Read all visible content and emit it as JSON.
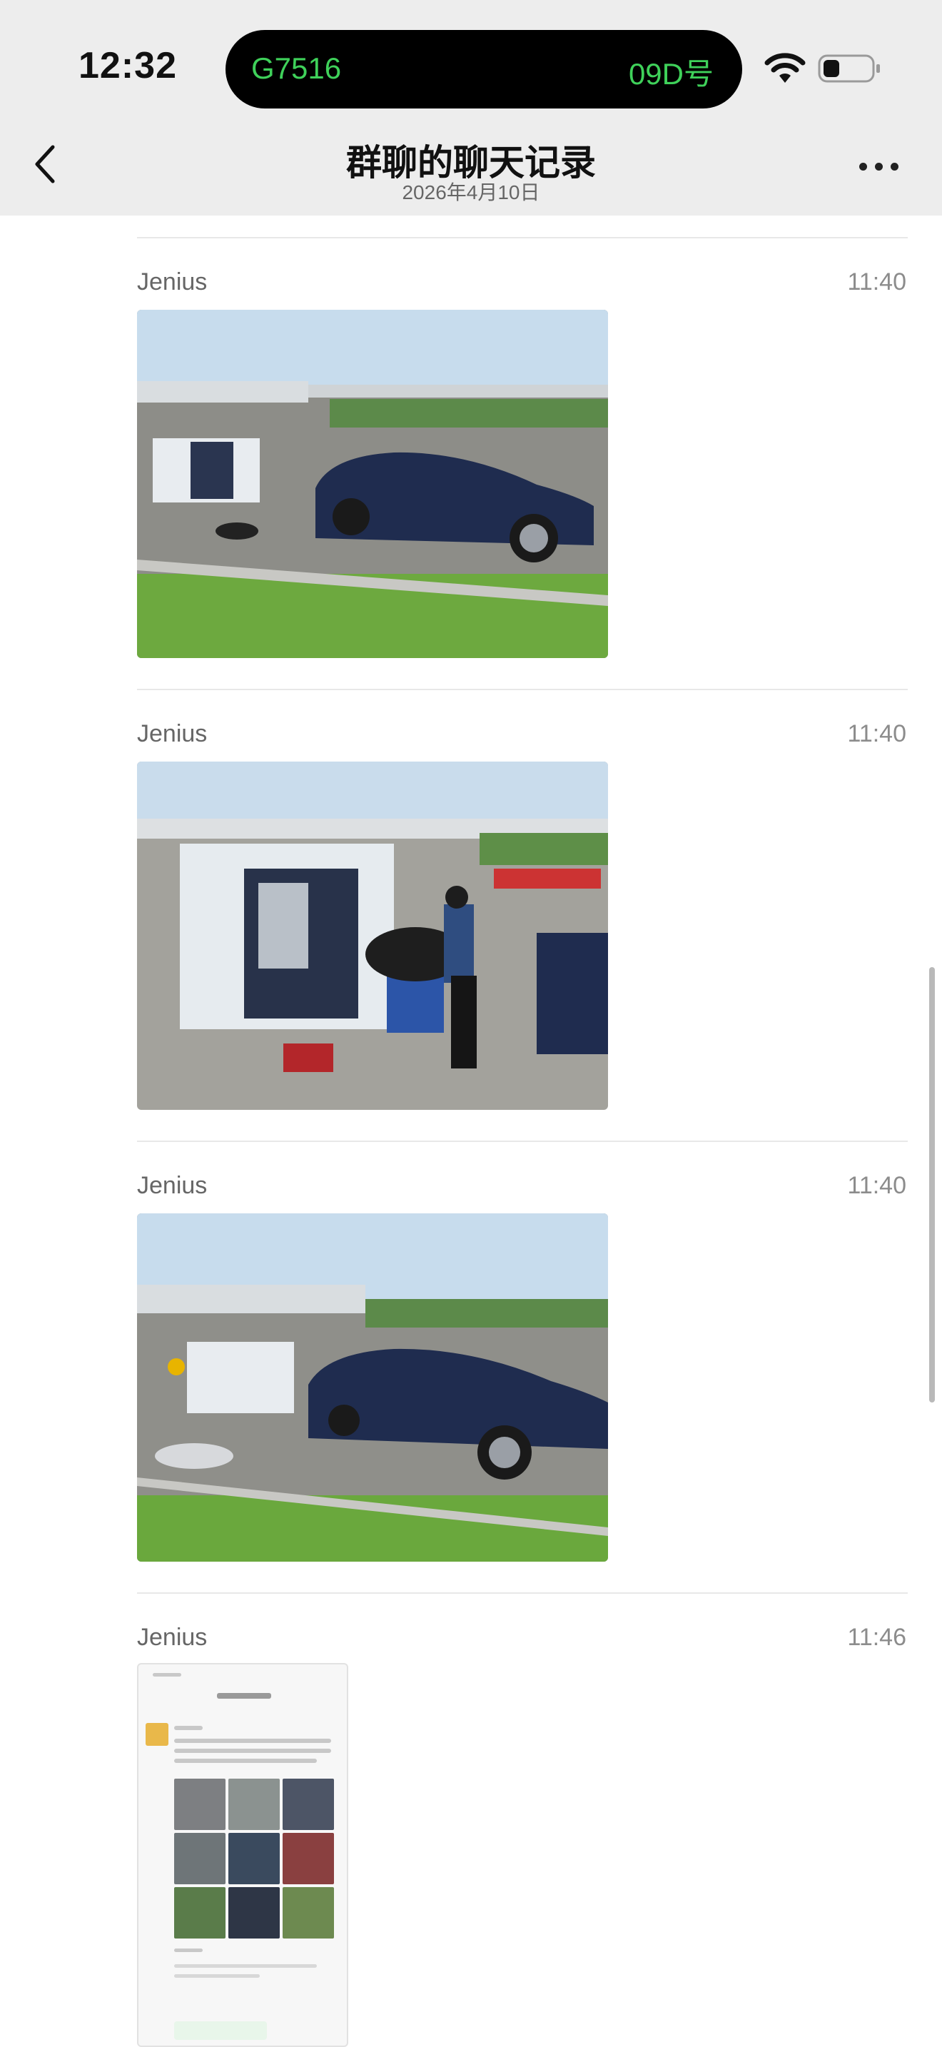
{
  "status_bar": {
    "time": "12:32",
    "island_left": "G7516",
    "island_right": "09D号"
  },
  "nav": {
    "title": "群聊的聊天记录",
    "subtitle": "2026年4月10日"
  },
  "messages": [
    {
      "sender": "Jenius",
      "time": "11:40",
      "content": "photo"
    },
    {
      "sender": "Jenius",
      "time": "11:40",
      "content": "photo"
    },
    {
      "sender": "Jenius",
      "time": "11:40",
      "content": "photo"
    },
    {
      "sender": "Jenius",
      "time": "11:46",
      "content": "screenshot"
    }
  ],
  "colors": {
    "nav_bg": "#ededed",
    "island_text": "#3fd15a",
    "divider": "#e8e8e8"
  }
}
